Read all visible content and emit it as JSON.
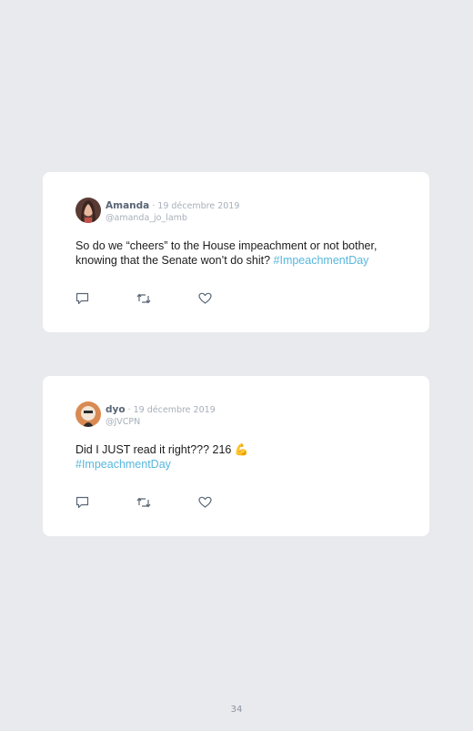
{
  "tweets": [
    {
      "name": "Amanda",
      "date": " · 19 décembre 2019",
      "handle": "@amanda_jo_lamb",
      "text": "So do we “cheers” to the House impeachment or not bother, knowing that the Senate won’t do shit? ",
      "hashtag": "#ImpeachmentDay",
      "avatar_icon": "woman-portrait-avatar"
    },
    {
      "name": "dyo",
      "date": " · 19 décembre 2019",
      "handle": "@JVCPN",
      "text": "Did I JUST read it right??? 216 💪",
      "hashtag": "#ImpeachmentDay",
      "avatar_icon": "cartoon-avatar"
    }
  ],
  "icons": {
    "reply": "reply-icon",
    "retweet": "retweet-icon",
    "like": "heart-icon"
  },
  "colors": {
    "background": "#e9eaee",
    "card": "#ffffff",
    "hashtag": "#57b7de",
    "name": "#5a6675",
    "muted": "#a7afba"
  },
  "page_number": "34"
}
